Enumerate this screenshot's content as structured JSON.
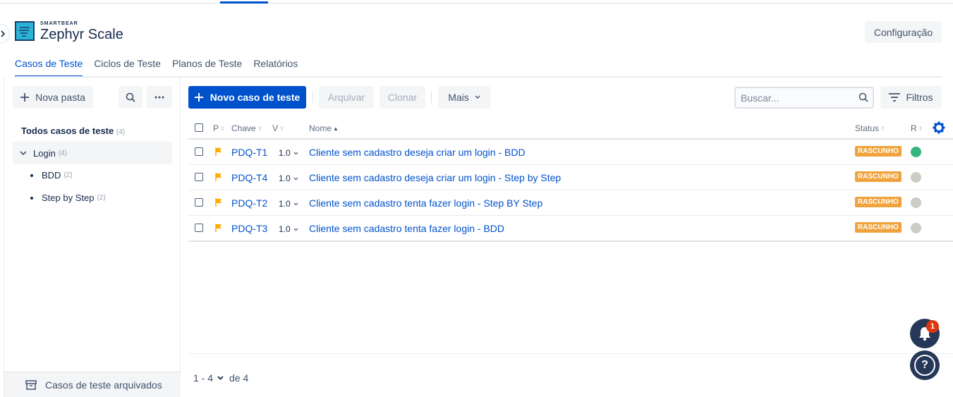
{
  "brand": {
    "small_label": "SMARTBEAR",
    "name": "Zephyr Scale"
  },
  "header": {
    "config_label": "Configuração"
  },
  "tabs": [
    {
      "label": "Casos de Teste",
      "active": true
    },
    {
      "label": "Ciclos de Teste",
      "active": false
    },
    {
      "label": "Planos de Teste",
      "active": false
    },
    {
      "label": "Relatórios",
      "active": false
    }
  ],
  "sidebar": {
    "new_folder_label": "Nova pasta",
    "all_label": "Todos casos de teste",
    "all_count": "(4)",
    "folders": [
      {
        "label": "Login",
        "count": "(4)"
      },
      {
        "label": "BDD",
        "count": "(2)"
      },
      {
        "label": "Step by Step",
        "count": "(2)"
      }
    ],
    "archived_label": "Casos de teste arquivados"
  },
  "toolbar": {
    "new_case_label": "Novo caso de teste",
    "archive_label": "Arquivar",
    "clone_label": "Clonar",
    "more_label": "Mais",
    "search_placeholder": "Buscar...",
    "filters_label": "Filtros"
  },
  "table": {
    "headers": {
      "priority": "P",
      "key": "Chave",
      "version": "V",
      "name": "Nome",
      "status": "Status",
      "result": "R"
    },
    "rows": [
      {
        "key": "PDQ-T1",
        "version": "1.0",
        "name": "Cliente sem cadastro deseja criar um login - BDD",
        "status": "RASCUNHO",
        "result_color": "#36b37e"
      },
      {
        "key": "PDQ-T4",
        "version": "1.0",
        "name": "Cliente sem cadastro deseja criar um login - Step by Step",
        "status": "RASCUNHO",
        "result_color": "#ccccc4"
      },
      {
        "key": "PDQ-T2",
        "version": "1.0",
        "name": "Cliente sem cadastro tenta fazer login - Step BY Step",
        "status": "RASCUNHO",
        "result_color": "#ccccc4"
      },
      {
        "key": "PDQ-T3",
        "version": "1.0",
        "name": "Cliente sem cadastro tenta fazer login - BDD",
        "status": "RASCUNHO",
        "result_color": "#ccccc4"
      }
    ]
  },
  "pagination": {
    "range": "1 - 4",
    "of_label": "de 4"
  },
  "notifications": {
    "count": "1"
  },
  "help": {
    "label": "?"
  },
  "colors": {
    "accent": "#0052cc",
    "status_badge": "#f0a33c",
    "priority_flag": "#ffab00"
  }
}
